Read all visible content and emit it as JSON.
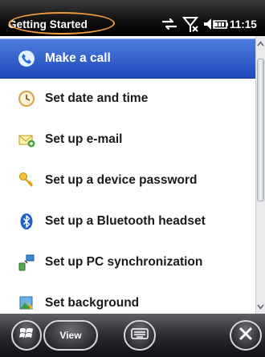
{
  "header": {
    "title": "Getting Started",
    "clock": "11:15",
    "status_icons": [
      "connectivity-icon",
      "signal-off-icon",
      "volume-icon",
      "battery-icon"
    ]
  },
  "menu": {
    "items": [
      {
        "label": "Make a call",
        "icon": "phone-icon",
        "selected": true
      },
      {
        "label": "Set date and time",
        "icon": "clock-icon",
        "selected": false
      },
      {
        "label": "Set up e-mail",
        "icon": "email-icon",
        "selected": false
      },
      {
        "label": "Set up a device password",
        "icon": "key-icon",
        "selected": false
      },
      {
        "label": "Set up a Bluetooth headset",
        "icon": "bluetooth-icon",
        "selected": false
      },
      {
        "label": "Set up PC synchronization",
        "icon": "sync-icon",
        "selected": false
      },
      {
        "label": "Set background",
        "icon": "background-icon",
        "selected": false
      }
    ]
  },
  "softkeys": {
    "view_label": "View"
  },
  "colors": {
    "selection": "#2f5fcf",
    "highlight_ring": "#f09a3e",
    "bar_background": "#1a1a1a"
  }
}
